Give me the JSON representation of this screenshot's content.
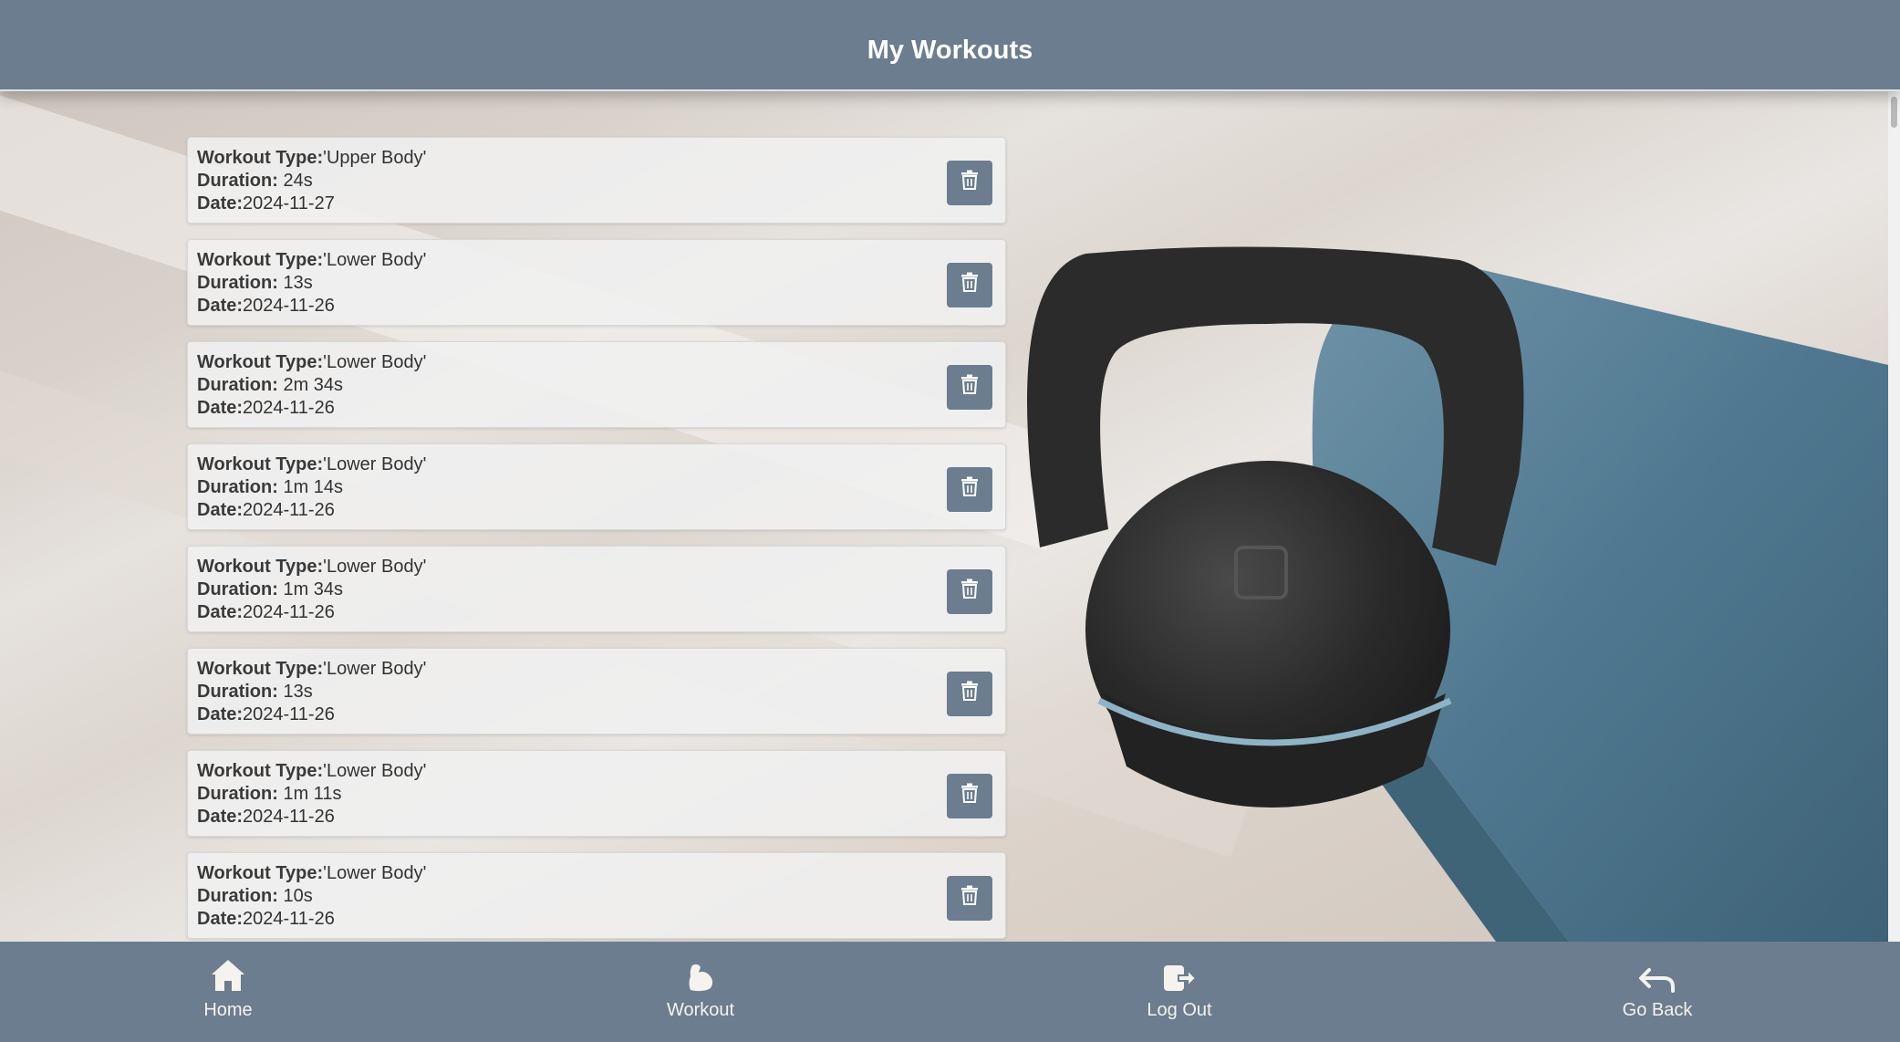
{
  "header": {
    "title": "My Workouts"
  },
  "workouts": [
    {
      "type_label": "Workout Type:",
      "type": "'Upper Body'",
      "duration_label": "Duration:",
      "duration": " 24s",
      "date_label": "Date:",
      "date": "2024-11-27"
    },
    {
      "type_label": "Workout Type:",
      "type": "'Lower Body'",
      "duration_label": "Duration:",
      "duration": " 13s",
      "date_label": "Date:",
      "date": "2024-11-26"
    },
    {
      "type_label": "Workout Type:",
      "type": "'Lower Body'",
      "duration_label": "Duration:",
      "duration": " 2m 34s",
      "date_label": "Date:",
      "date": "2024-11-26"
    },
    {
      "type_label": "Workout Type:",
      "type": "'Lower Body'",
      "duration_label": "Duration:",
      "duration": " 1m 14s",
      "date_label": "Date:",
      "date": "2024-11-26"
    },
    {
      "type_label": "Workout Type:",
      "type": "'Lower Body'",
      "duration_label": "Duration:",
      "duration": " 1m 34s",
      "date_label": "Date:",
      "date": "2024-11-26"
    },
    {
      "type_label": "Workout Type:",
      "type": "'Lower Body'",
      "duration_label": "Duration:",
      "duration": " 13s",
      "date_label": "Date:",
      "date": "2024-11-26"
    },
    {
      "type_label": "Workout Type:",
      "type": "'Lower Body'",
      "duration_label": "Duration:",
      "duration": " 1m 11s",
      "date_label": "Date:",
      "date": "2024-11-26"
    },
    {
      "type_label": "Workout Type:",
      "type": "'Lower Body'",
      "duration_label": "Duration:",
      "duration": " 10s",
      "date_label": "Date:",
      "date": "2024-11-26"
    }
  ],
  "delete_icon": "trash-icon",
  "nav": [
    {
      "label": "Home",
      "icon": "home-icon"
    },
    {
      "label": "Workout",
      "icon": "flexed-bicep-icon"
    },
    {
      "label": "Log Out",
      "icon": "logout-icon"
    },
    {
      "label": "Go Back",
      "icon": "back-arrow-icon"
    }
  ],
  "colors": {
    "bar": "#6b7d8f",
    "button": "#6b7d8f",
    "card": "#f0f0f0",
    "text": "#333333"
  }
}
